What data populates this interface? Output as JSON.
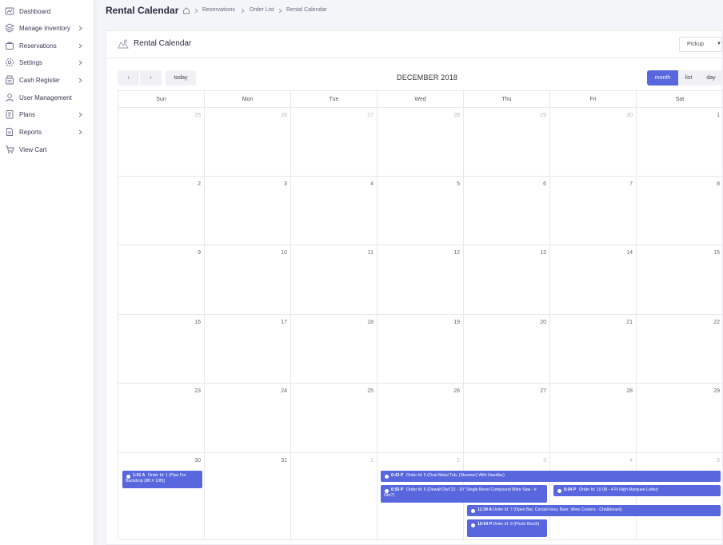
{
  "sidebar": {
    "items": [
      {
        "label": "Dashboard",
        "icon": "dashboard-icon",
        "has_children": false
      },
      {
        "label": "Manage Inventory",
        "icon": "inventory-icon",
        "has_children": true
      },
      {
        "label": "Reservations",
        "icon": "reservations-icon",
        "has_children": true
      },
      {
        "label": "Settings",
        "icon": "settings-icon",
        "has_children": true
      },
      {
        "label": "Cash Register",
        "icon": "cash-register-icon",
        "has_children": true
      },
      {
        "label": "User Management",
        "icon": "user-management-icon",
        "has_children": false
      },
      {
        "label": "Plans",
        "icon": "plans-icon",
        "has_children": true
      },
      {
        "label": "Reports",
        "icon": "reports-icon",
        "has_children": true
      },
      {
        "label": "View Cart",
        "icon": "cart-icon",
        "has_children": false
      }
    ]
  },
  "header": {
    "title": "Rental Calendar",
    "breadcrumb": [
      "Reservations",
      "Order List",
      "Rental Calendar"
    ]
  },
  "card": {
    "title": "Rental Calendar",
    "filter_value": "Pickup"
  },
  "toolbar": {
    "prev_label": "‹",
    "next_label": "›",
    "today_label": "today",
    "title": "DECEMBER 2018",
    "views": [
      "month",
      "list",
      "day"
    ],
    "active_view": "month"
  },
  "calendar": {
    "weekdays": [
      "Sun",
      "Mon",
      "Tue",
      "Wed",
      "Thu",
      "Fri",
      "Sat"
    ],
    "weeks": [
      [
        {
          "d": "25",
          "other": true
        },
        {
          "d": "26",
          "other": true
        },
        {
          "d": "27",
          "other": true
        },
        {
          "d": "28",
          "other": true
        },
        {
          "d": "29",
          "other": true
        },
        {
          "d": "30",
          "other": true
        },
        {
          "d": "1",
          "other": false
        }
      ],
      [
        {
          "d": "2",
          "other": false
        },
        {
          "d": "3",
          "other": false
        },
        {
          "d": "4",
          "other": false
        },
        {
          "d": "5",
          "other": false
        },
        {
          "d": "6",
          "other": false
        },
        {
          "d": "7",
          "other": false
        },
        {
          "d": "8",
          "other": false
        }
      ],
      [
        {
          "d": "9",
          "other": false
        },
        {
          "d": "10",
          "other": false
        },
        {
          "d": "11",
          "other": false
        },
        {
          "d": "12",
          "other": false
        },
        {
          "d": "13",
          "other": false
        },
        {
          "d": "14",
          "other": false
        },
        {
          "d": "15",
          "other": false
        }
      ],
      [
        {
          "d": "16",
          "other": false
        },
        {
          "d": "17",
          "other": false
        },
        {
          "d": "18",
          "other": false
        },
        {
          "d": "19",
          "other": false
        },
        {
          "d": "20",
          "other": false
        },
        {
          "d": "21",
          "other": false
        },
        {
          "d": "22",
          "other": false
        }
      ],
      [
        {
          "d": "23",
          "other": false
        },
        {
          "d": "24",
          "other": false
        },
        {
          "d": "25",
          "other": false
        },
        {
          "d": "26",
          "other": false
        },
        {
          "d": "27",
          "other": false
        },
        {
          "d": "28",
          "other": false
        },
        {
          "d": "29",
          "other": false
        }
      ],
      [
        {
          "d": "30",
          "other": false
        },
        {
          "d": "31",
          "other": false
        },
        {
          "d": "1",
          "other": true
        },
        {
          "d": "2",
          "other": true
        },
        {
          "d": "3",
          "other": true
        },
        {
          "d": "4",
          "other": true
        },
        {
          "d": "5",
          "other": true
        }
      ]
    ],
    "events": [
      {
        "time": "1:01 A",
        "title": "Order Id: 1 (Pipe For Backdrop (8ft X 10ft))"
      },
      {
        "time": "6:43 P",
        "title": "Order Id: 5 (Oval Metal Tub, (Steamer) With Handles)"
      },
      {
        "time": "6:55 P",
        "title": "Order Id: 6 (Dewalt Dw713 - 10\" Single Bevel Compound Mitre Saw - # Obr7)"
      },
      {
        "time": "11:39 A",
        "title": "Order Id: 7 (Open Bar, Coctail Hour, Beer, Wine Coolers - Chalkboard)"
      },
      {
        "time": "10:54 P",
        "title": "Order Id: 9 (Photo Booth)"
      },
      {
        "time": "6:04 P",
        "title": "Order Id: 10 (M - 4 Ft High Marquee Letter)"
      }
    ]
  },
  "colors": {
    "accent": "#5867dd",
    "grid_line": "#e8e8ee"
  }
}
